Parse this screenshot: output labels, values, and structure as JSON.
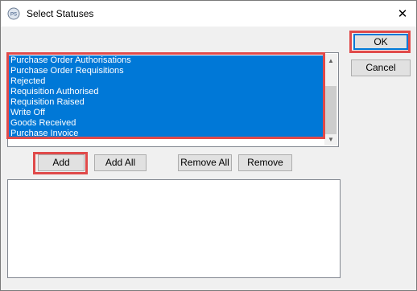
{
  "window": {
    "title": "Select Statuses",
    "app_icon_glyph": "PS",
    "close_glyph": "✕"
  },
  "buttons": {
    "ok": "OK",
    "cancel": "Cancel",
    "add": "Add",
    "add_all": "Add All",
    "remove_all": "Remove All",
    "remove": "Remove"
  },
  "available_list": {
    "items": [
      {
        "label": "Purchase Order Authorisations",
        "selected": true
      },
      {
        "label": "Purchase Order Requisitions",
        "selected": true
      },
      {
        "label": "Rejected",
        "selected": true
      },
      {
        "label": "Requisition Authorised",
        "selected": true
      },
      {
        "label": "Requisition Raised",
        "selected": true
      },
      {
        "label": "Write Off",
        "selected": true
      },
      {
        "label": "Goods Received",
        "selected": true
      },
      {
        "label": "Purchase Invoice",
        "selected": true
      }
    ],
    "scroll_up_glyph": "▲",
    "scroll_down_glyph": "▼"
  },
  "selected_list": {
    "items": []
  },
  "colors": {
    "selection": "#0078d7",
    "highlight": "#e04a4a"
  }
}
